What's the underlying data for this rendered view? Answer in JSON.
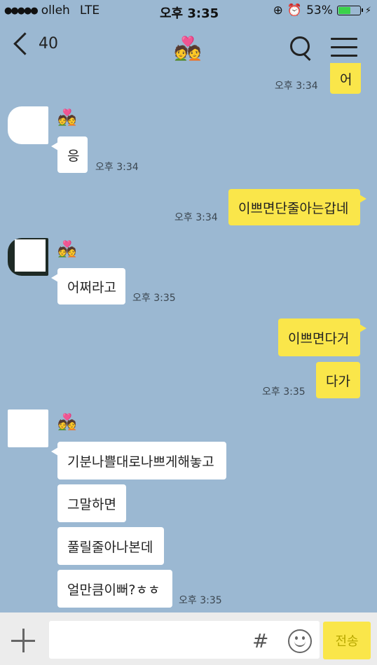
{
  "status_bar": {
    "signal": "●●●●●",
    "carrier": "olleh",
    "network": "LTE",
    "time": "오후 3:35",
    "icons": [
      "orientation-lock-icon",
      "alarm-icon"
    ],
    "battery_percent": "53%",
    "battery_level": 0.53,
    "charging_icon": "⚡"
  },
  "header": {
    "back_count": "40",
    "title_emoji": "💑",
    "icons": [
      "search-icon",
      "menu-icon"
    ]
  },
  "messages": [
    {
      "side": "out",
      "text": "어",
      "time": "오후 3:34"
    },
    {
      "side": "in",
      "sender_emoji": "💑",
      "text": "응",
      "time": "오후 3:34"
    },
    {
      "side": "out",
      "text": "이쁘면단줄아는갑네",
      "time": "오후 3:34"
    },
    {
      "side": "in",
      "sender_emoji": "💑",
      "text": "어쩌라고",
      "time": "오후 3:35"
    },
    {
      "side": "out",
      "text": "이쁘면다거",
      "time": ""
    },
    {
      "side": "out",
      "text": "다가",
      "time": "오후 3:35"
    },
    {
      "side": "in",
      "sender_emoji": "💑",
      "text": "기분나쁠대로나쁘게해놓고",
      "time": ""
    },
    {
      "side": "in",
      "text": "그말하면",
      "time": ""
    },
    {
      "side": "in",
      "text": "풀릴줄아나본데",
      "time": ""
    },
    {
      "side": "in",
      "text": "얼만큼이뻐?ㅎㅎ",
      "time": "오후 3:35"
    }
  ],
  "input_bar": {
    "plus_icon": "plus-icon",
    "hash_label": "#",
    "emoji_icon": "smiley-icon",
    "send_label": "전송"
  },
  "colors": {
    "background": "#9bb8d2",
    "my_bubble": "#fae64a",
    "their_bubble": "#ffffff",
    "battery": "#3bd24a"
  }
}
